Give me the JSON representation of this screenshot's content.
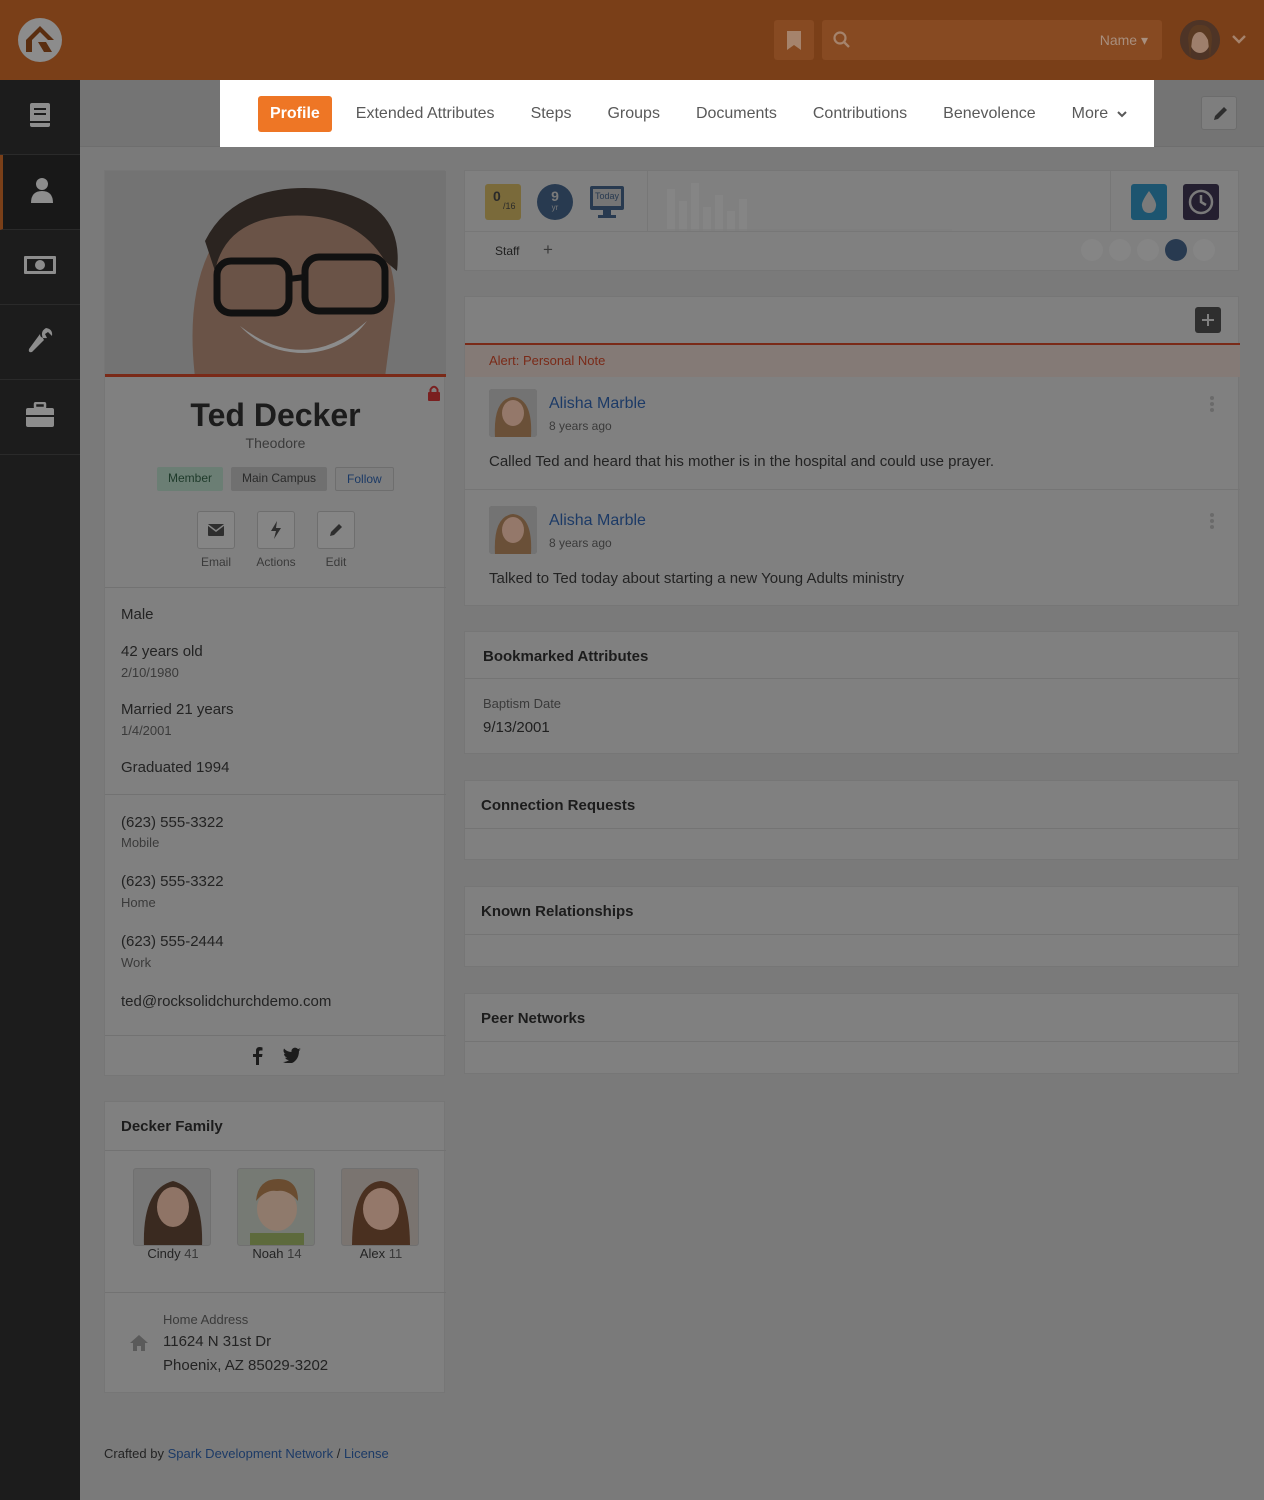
{
  "header": {
    "search_scope": "Name"
  },
  "tabs": [
    {
      "label": "Profile"
    },
    {
      "label": "Extended Attributes"
    },
    {
      "label": "Steps"
    },
    {
      "label": "Groups"
    },
    {
      "label": "Documents"
    },
    {
      "label": "Contributions"
    },
    {
      "label": "Benevolence"
    },
    {
      "label": "More"
    }
  ],
  "person": {
    "name": "Ted Decker",
    "nickname": "Theodore",
    "badges": {
      "member": "Member",
      "campus": "Main Campus",
      "follow": "Follow"
    },
    "actions": {
      "email": "Email",
      "actions": "Actions",
      "edit": "Edit"
    },
    "gender": "Male",
    "age": "42 years old",
    "birthdate": "2/10/1980",
    "married": "Married 21 years",
    "anniversary": "1/4/2001",
    "graduated": "Graduated 1994",
    "phones": [
      {
        "number": "(623) 555-3322",
        "type": "Mobile"
      },
      {
        "number": "(623) 555-3322",
        "type": "Home"
      },
      {
        "number": "(623) 555-2444",
        "type": "Work"
      }
    ],
    "email": "ted@rocksolidchurchdemo.com"
  },
  "family": {
    "title": "Decker Family",
    "members": [
      {
        "name": "Cindy",
        "age": "41"
      },
      {
        "name": "Noah",
        "age": "14"
      },
      {
        "name": "Alex",
        "age": "11"
      }
    ],
    "address_label": "Home Address",
    "address_line1": "11624 N 31st Dr",
    "address_line2": "Phoenix, AZ 85029-3202"
  },
  "badge_bar": {
    "attendance_value": "0",
    "attendance_total": "/16",
    "years_value": "9",
    "years_unit": "yr",
    "today_label": "Today",
    "tag": "Staff",
    "add_tag": "+"
  },
  "notes": {
    "alert_label": "Alert: Personal Note",
    "items": [
      {
        "author": "Alisha Marble",
        "time": "8 years ago",
        "text": "Called Ted and heard that his mother is in the hospital and could use prayer."
      },
      {
        "author": "Alisha Marble",
        "time": "8 years ago",
        "text": "Talked to Ted today about starting a new Young Adults ministry"
      }
    ]
  },
  "bookmarked": {
    "title": "Bookmarked Attributes",
    "attr_label": "Baptism Date",
    "attr_value": "9/13/2001"
  },
  "connection_requests": {
    "title": "Connection Requests"
  },
  "known_relationships": {
    "title": "Known Relationships"
  },
  "peer_networks": {
    "title": "Peer Networks"
  },
  "footer": {
    "prefix": "Crafted by",
    "org": "Spark Development Network",
    "sep": "/",
    "license": "License"
  },
  "colors": {
    "accent": "#ee7625",
    "brand_header": "#7a3f18",
    "link": "#1c3a66"
  }
}
